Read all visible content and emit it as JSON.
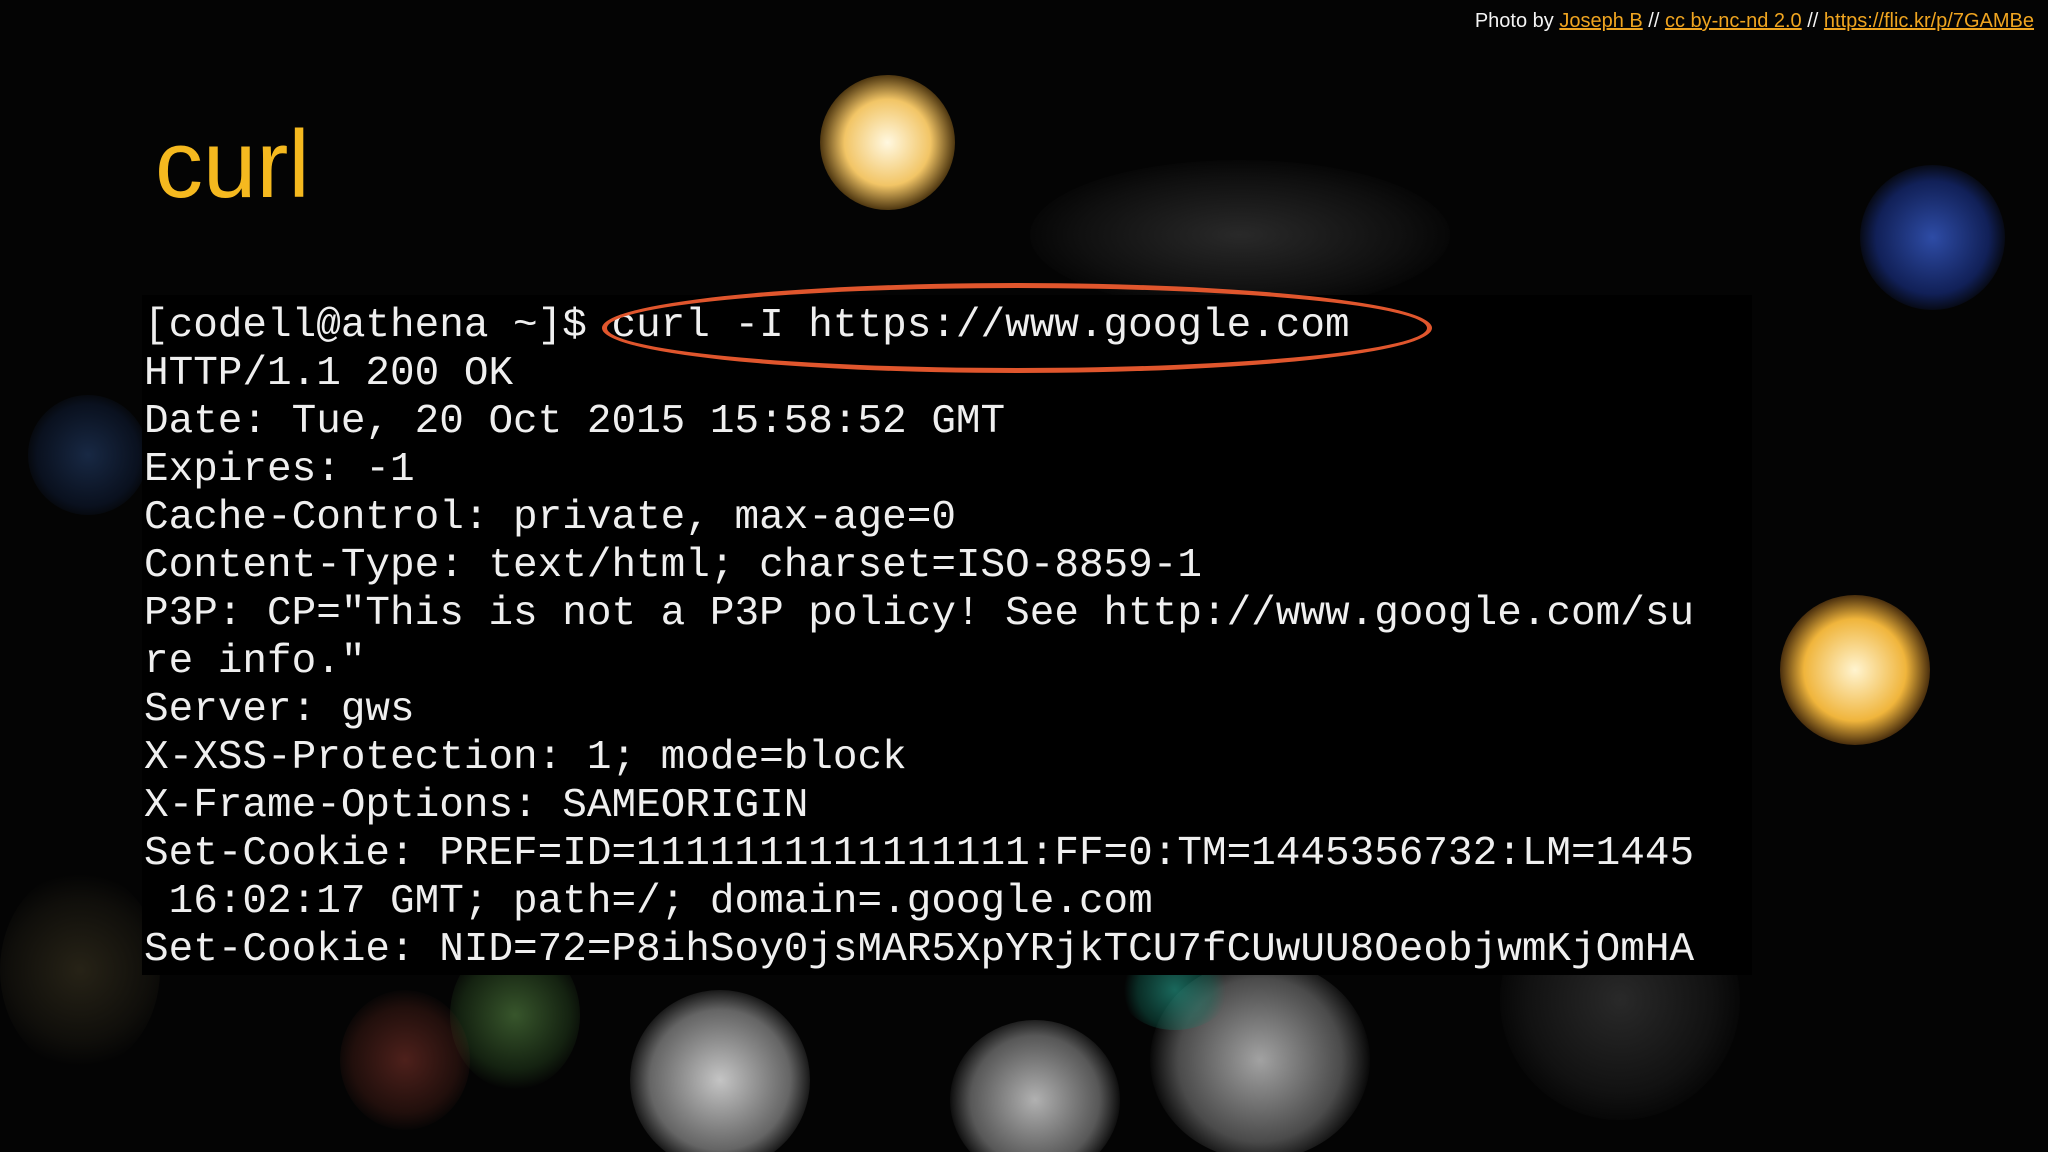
{
  "slide": {
    "title": "curl"
  },
  "credit": {
    "prefix": "Photo by ",
    "author": "Joseph B",
    "sep1": " // ",
    "license": "cc by-nc-nd 2.0",
    "sep2": " // ",
    "url": "https://flic.kr/p/7GAMBe"
  },
  "terminal": {
    "lines": [
      "[codell@athena ~]$ curl -I https://www.google.com",
      "HTTP/1.1 200 OK",
      "Date: Tue, 20 Oct 2015 15:58:52 GMT",
      "Expires: -1",
      "Cache-Control: private, max-age=0",
      "Content-Type: text/html; charset=ISO-8859-1",
      "P3P: CP=\"This is not a P3P policy! See http://www.google.com/su",
      "re info.\"",
      "Server: gws",
      "X-XSS-Protection: 1; mode=block",
      "X-Frame-Options: SAMEORIGIN",
      "Set-Cookie: PREF=ID=1111111111111111:FF=0:TM=1445356732:LM=1445",
      " 16:02:17 GMT; path=/; domain=.google.com",
      "Set-Cookie: NID=72=P8ihSoy0jsMAR5XpYRjkTCU7fCUwUU8OeobjwmKjOmHA"
    ]
  },
  "colors": {
    "title": "#f5b91f",
    "highlight": "#e0562d",
    "link": "#f0a520",
    "terminal_text": "#efefef"
  }
}
